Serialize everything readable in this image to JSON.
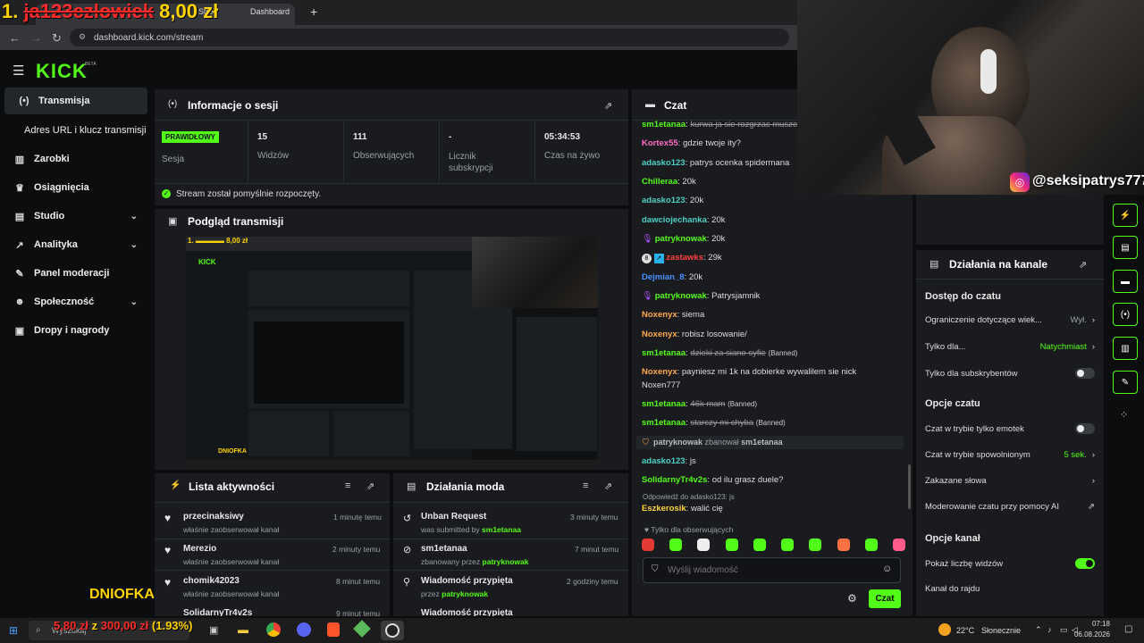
{
  "overlay": {
    "prefix": "1.",
    "struck": "ja123czlowiek",
    "amount": "8,00 zł",
    "name": "DNIOFKA",
    "goal_current": "5,80 zł",
    "goal_sep": "z",
    "goal_total": "300,00 zł",
    "goal_pct": "(1.93%)"
  },
  "browser": {
    "tab_title": "Dashboard",
    "tab_partial": "Stre",
    "url": "dashboard.kick.com/stream"
  },
  "logo": {
    "text": "KICK",
    "beta": "BETA"
  },
  "sidebar": {
    "items": [
      {
        "label": "Transmisja",
        "icon": "broadcast-icon",
        "active": true
      },
      {
        "label": "Adres URL i klucz transmisji"
      },
      {
        "label": "Zarobki",
        "icon": "chart-icon"
      },
      {
        "label": "Osiągnięcia",
        "icon": "trophy-icon"
      },
      {
        "label": "Studio",
        "icon": "studio-icon",
        "chevron": true
      },
      {
        "label": "Analityka",
        "icon": "analytics-icon",
        "chevron": true
      },
      {
        "label": "Panel moderacji",
        "icon": "wrench-icon"
      },
      {
        "label": "Społeczność",
        "icon": "community-icon",
        "chevron": true
      },
      {
        "label": "Dropy i nagrody",
        "icon": "drops-icon"
      }
    ]
  },
  "session": {
    "title": "Informacje o sesji",
    "status_badge": "PRAWIDŁOWY",
    "status_label": "Sesja",
    "stats": [
      {
        "value": "15",
        "label": "Widzów"
      },
      {
        "value": "111",
        "label": "Obserwujących"
      },
      {
        "value": "-",
        "label": "Licznik subskrypcji"
      },
      {
        "value": "05:34:53",
        "label": "Czas na żywo"
      }
    ],
    "success": "Stream został pomyślnie rozpoczęty."
  },
  "preview": {
    "title": "Podgląd transmisji"
  },
  "activity": {
    "title": "Lista aktywności",
    "items": [
      {
        "name": "przecinaksiwy",
        "desc": "właśnie zaobserwował kanał",
        "time": "1 minutę temu"
      },
      {
        "name": "Merezio",
        "desc": "właśnie zaobserwował kanał",
        "time": "2 minuty temu"
      },
      {
        "name": "chomik42023",
        "desc": "właśnie zaobserwował kanał",
        "time": "8 minut temu"
      },
      {
        "name": "SolidarnyTr4v2s",
        "desc": "",
        "time": "9 minut temu"
      }
    ]
  },
  "mod_actions": {
    "title": "Działania moda",
    "items": [
      {
        "title": "Unban Request",
        "pre": "was submitted by",
        "user": "sm1etanaa",
        "time": "3 minuty temu",
        "icon": "history-icon"
      },
      {
        "title": "sm1etanaa",
        "pre": "zbanowany przez",
        "user": "patryknowak",
        "time": "7 minut temu",
        "icon": "ban-icon"
      },
      {
        "title": "Wiadomość przypięta",
        "pre": "przez",
        "user": "patryknowak",
        "time": "2 godziny temu",
        "icon": "pin-icon"
      },
      {
        "title": "Wiadomość przypięta",
        "pre": "",
        "user": "",
        "time": "",
        "icon": "pin-icon"
      }
    ]
  },
  "chat": {
    "title": "Czat",
    "lines": [
      {
        "user": "sm1etanaa",
        "color": "#53fc18",
        "text": "kurwa ja sie rozgrzac musze",
        "deleted": true
      },
      {
        "user": "Kortex55",
        "color": "#ff6ec7",
        "text": "gdzie twoje ity?"
      },
      {
        "user": "adasko123",
        "color": "#4fd1c5",
        "text": "patrys ocenka spidermana"
      },
      {
        "user": "Chilleraa",
        "color": "#53fc18",
        "text": "20k"
      },
      {
        "user": "adasko123",
        "color": "#4fd1c5",
        "text": "20k"
      },
      {
        "user": "dawciojechanka",
        "color": "#4fd1c5",
        "text": "20k"
      },
      {
        "user": "patryknowak",
        "color": "#53fc18",
        "text": "20k",
        "badge": "mic"
      },
      {
        "user": "zastawks",
        "color": "#ff4040",
        "text": "29k",
        "badge": "two"
      },
      {
        "user": "Dejmian_8",
        "color": "#4a90ff",
        "text": "20k"
      },
      {
        "user": "patryknowak",
        "color": "#53fc18",
        "text": "Patrysjamnik",
        "badge": "mic"
      },
      {
        "user": "Noxenyx",
        "color": "#ffa94d",
        "text": "siema"
      },
      {
        "user": "Noxenyx",
        "color": "#ffa94d",
        "text": "robisz losowanie/"
      },
      {
        "user": "sm1etanaa",
        "color": "#53fc18",
        "text": "dzieki za siano syfie",
        "deleted": true,
        "banned": "(Banned)"
      },
      {
        "user": "Noxenyx",
        "color": "#ffa94d",
        "text": "payniesz mi 1k na dobierke wywalilem sie nick"
      },
      {
        "user": "",
        "color": "#ddd",
        "text": "Noxen777"
      },
      {
        "user": "sm1etanaa",
        "color": "#53fc18",
        "text": "46k mam",
        "deleted": true,
        "banned": "(Banned)"
      },
      {
        "user": "sm1etanaa",
        "color": "#53fc18",
        "text": "starczy mi chyba",
        "deleted": true,
        "banned": "(Banned)"
      },
      {
        "user": "adasko123",
        "color": "#4fd1c5",
        "text": "js"
      },
      {
        "user": "SolidarnyTr4v2s",
        "color": "#53fc18",
        "text": "od ilu grasz duele?"
      },
      {
        "user": "Eszkerosik",
        "color": "#ffd43b",
        "text": "walić cię"
      }
    ],
    "ban_notice": {
      "mod": "patryknowak",
      "action": "zbanował",
      "user": "sm1etanaa"
    },
    "reply_to": "Odpowiedź do adasko123: js",
    "followers_only": "Tylko dla obserwujących",
    "placeholder": "Wyślij wiadomość",
    "send": "Czat"
  },
  "webcam": {
    "handle": "@seksipatrys777"
  },
  "channel": {
    "title": "Działania na kanale",
    "chat_access": "Dostęp do czatu",
    "rows1": [
      {
        "label": "Ograniczenie dotyczące wiek...",
        "value": "Wył."
      },
      {
        "label": "Tylko dla...",
        "value": "Natychmiast"
      },
      {
        "label": "Tylko dla subskrybentów"
      }
    ],
    "chat_options": "Opcje czatu",
    "rows2": [
      {
        "label": "Czat w trybie tylko emotek"
      },
      {
        "label": "Czat w trybie spowolnionym",
        "value": "5 sek."
      },
      {
        "label": "Zakazane słowa"
      },
      {
        "label": "Moderowanie czatu przy pomocy AI"
      }
    ],
    "channel_options": "Opcje kanał",
    "rows3": [
      {
        "label": "Pokaż liczbę widzów"
      },
      {
        "label": "Kanał do rajdu"
      }
    ]
  },
  "taskbar": {
    "search": "Wyszukaj",
    "temp": "22°C",
    "weather": "Słonecznie",
    "time": "07:18",
    "date": "06.08.2026"
  }
}
